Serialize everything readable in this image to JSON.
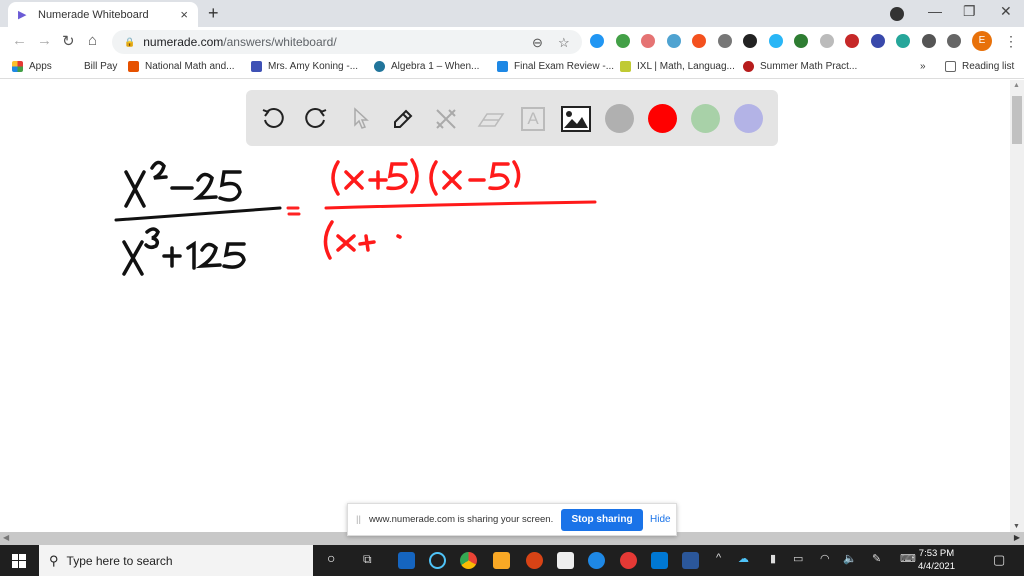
{
  "browser": {
    "tab": {
      "title": "Numerade Whiteboard",
      "close": "×"
    },
    "new_tab": "+",
    "window_controls": {
      "minimize": "—",
      "restore": "❐",
      "close": "✕"
    },
    "nav": {
      "back": "←",
      "forward": "→",
      "reload": "↻",
      "home": "⌂"
    },
    "address": {
      "domain": "numerade.com",
      "path": "/answers/whiteboard/"
    },
    "profile_initial": "E",
    "extensions": [
      {
        "name": "ext-blue-circle",
        "color": "#2196f3"
      },
      {
        "name": "ext-green-plus",
        "color": "#43a047"
      },
      {
        "name": "ext-red-badge",
        "color": "#e57373"
      },
      {
        "name": "ext-cloud",
        "color": "#4fa3d1"
      },
      {
        "name": "ext-orange",
        "color": "#f4511e"
      },
      {
        "name": "ext-gray-circle",
        "color": "#777777"
      },
      {
        "name": "ext-black-red",
        "color": "#222222"
      },
      {
        "name": "ext-diamond",
        "color": "#29b6f6"
      },
      {
        "name": "ext-green-cast",
        "color": "#2e7d32"
      },
      {
        "name": "ext-gray-line",
        "color": "#bbbbbb"
      },
      {
        "name": "ext-pdf",
        "color": "#c62828"
      },
      {
        "name": "ext-k",
        "color": "#3949ab"
      },
      {
        "name": "ext-green-face",
        "color": "#26a69a"
      },
      {
        "name": "ext-puzzle",
        "color": "#555555"
      },
      {
        "name": "ext-cast",
        "color": "#666666"
      }
    ],
    "bookmarks": [
      {
        "label": "Apps",
        "color": "#e53935"
      },
      {
        "label": "Bill Pay",
        "color": ""
      },
      {
        "label": "National Math and...",
        "color": "#e65100"
      },
      {
        "label": "Mrs. Amy Koning -...",
        "color": "#3f51b5"
      },
      {
        "label": "Algebra 1 – When...",
        "color": "#21759b"
      },
      {
        "label": "Final Exam Review -...",
        "color": "#1e88e5"
      },
      {
        "label": "IXL | Math, Languag...",
        "color": "#c0ca33"
      },
      {
        "label": "Summer Math Pract...",
        "color": "#b71c1c"
      }
    ],
    "bookmarks_overflow": "»",
    "reading_list": "Reading list"
  },
  "whiteboard": {
    "tools": [
      "undo",
      "redo",
      "select",
      "pen",
      "tools",
      "eraser",
      "text",
      "image"
    ],
    "colors": [
      "#b0b0b0",
      "#ff0000",
      "#a8d1a8",
      "#b3b3e6"
    ],
    "text_tool_glyph": "A",
    "math": {
      "numerator": "x² − 25",
      "denominator": "x³ + 125",
      "equals": "=",
      "rhs_numerator": "(x+5)(x−5)",
      "rhs_denominator_partial": "(x+"
    }
  },
  "share_bar": {
    "message": "www.numerade.com is sharing your screen.",
    "stop_button": "Stop sharing",
    "hide_link": "Hide"
  },
  "taskbar": {
    "search_placeholder": "Type here to search",
    "time": "7:53 PM",
    "date": "4/4/2021"
  }
}
